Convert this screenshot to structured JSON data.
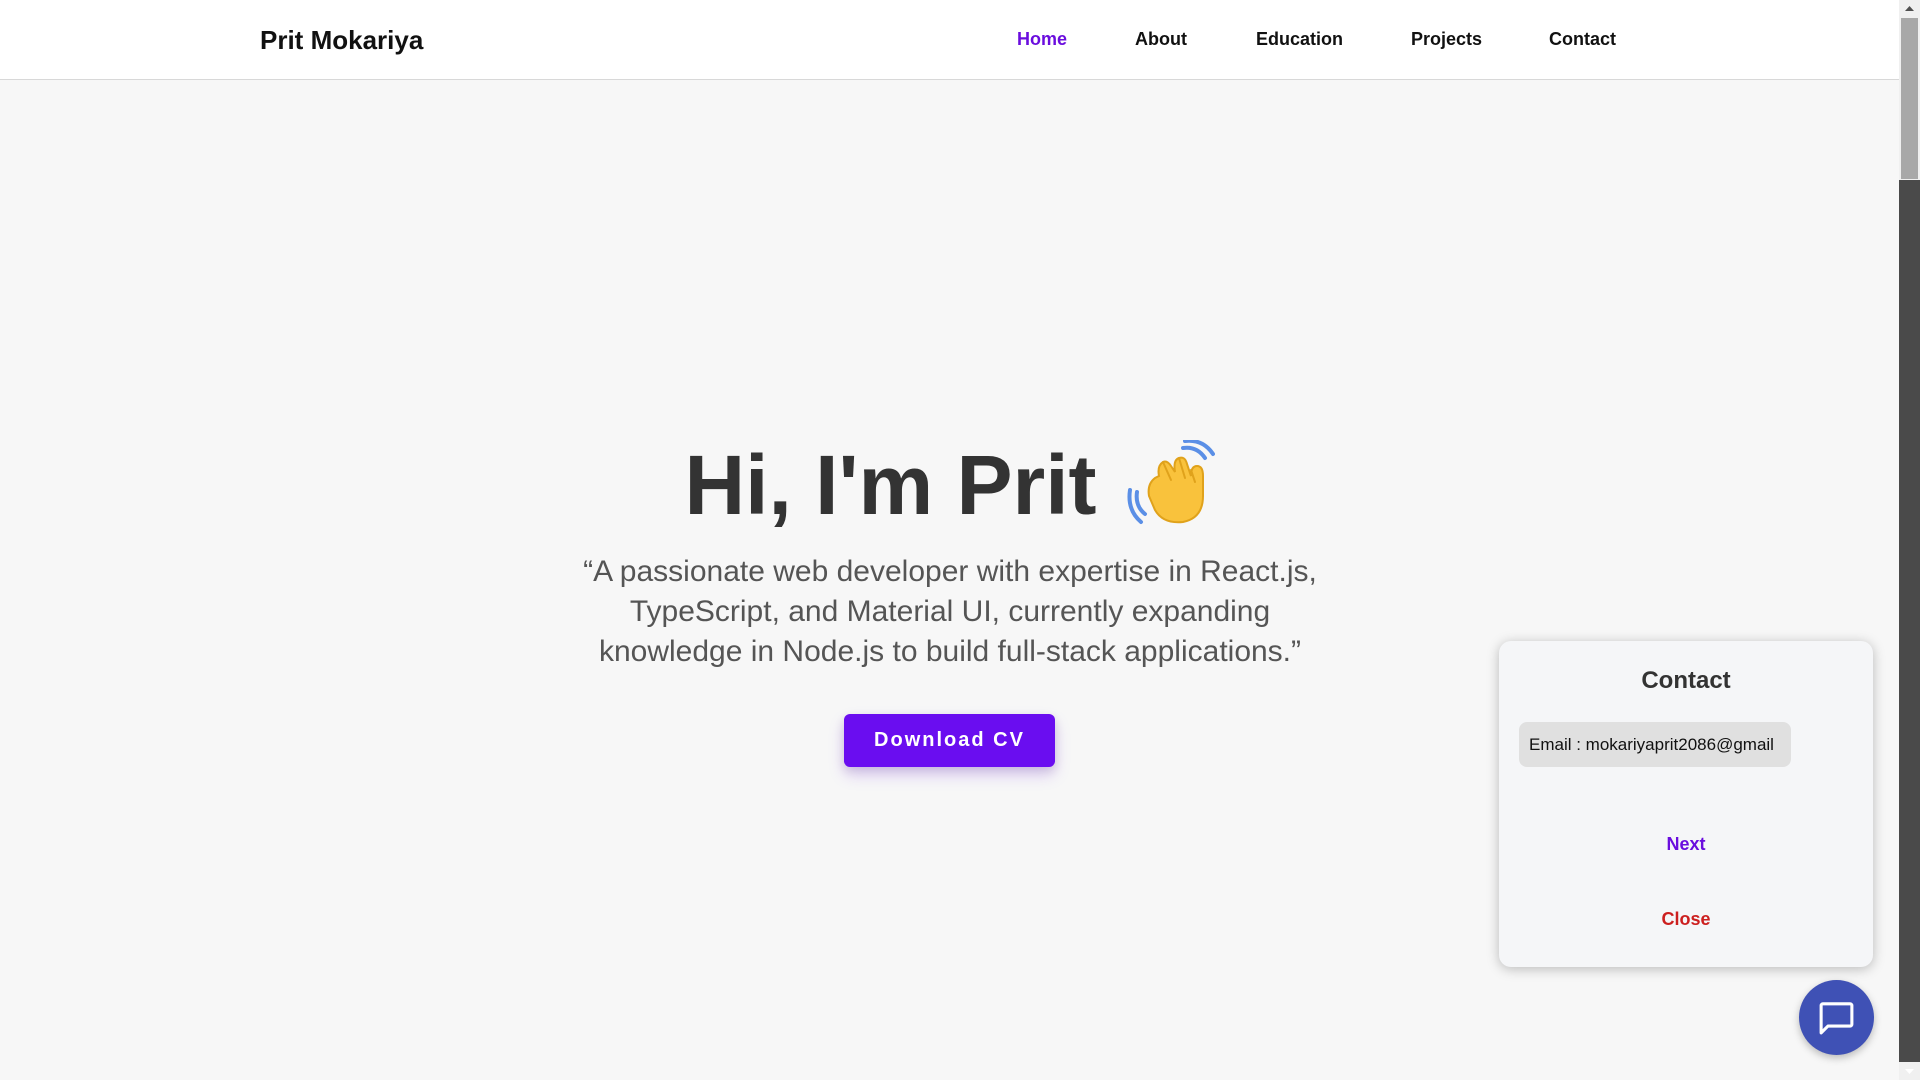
{
  "navbar": {
    "brand": "Prit Mokariya",
    "links": [
      {
        "label": "Home",
        "active": true
      },
      {
        "label": "About",
        "active": false
      },
      {
        "label": "Education",
        "active": false
      },
      {
        "label": "Projects",
        "active": false
      },
      {
        "label": "Contact",
        "active": false
      }
    ]
  },
  "hero": {
    "title": "Hi, I'm Prit",
    "wave_icon": "waving-hand-icon",
    "quote_lines": [
      "“A passionate web developer with expertise in React.js,",
      "TypeScript, and Material UI, currently expanding",
      "knowledge in Node.js to build full-stack applications.”"
    ],
    "download_label": "Download CV"
  },
  "contact_card": {
    "title": "Contact",
    "email_text": "Email : mokariyaprit2086@gmail",
    "next_label": "Next",
    "close_label": "Close"
  },
  "chat_fab": {
    "icon": "chat-bubble-icon"
  },
  "colors": {
    "accent": "#6a0df0",
    "close": "#cc1f1f",
    "fab": "#3f51b5",
    "background": "#f7f7f7"
  }
}
